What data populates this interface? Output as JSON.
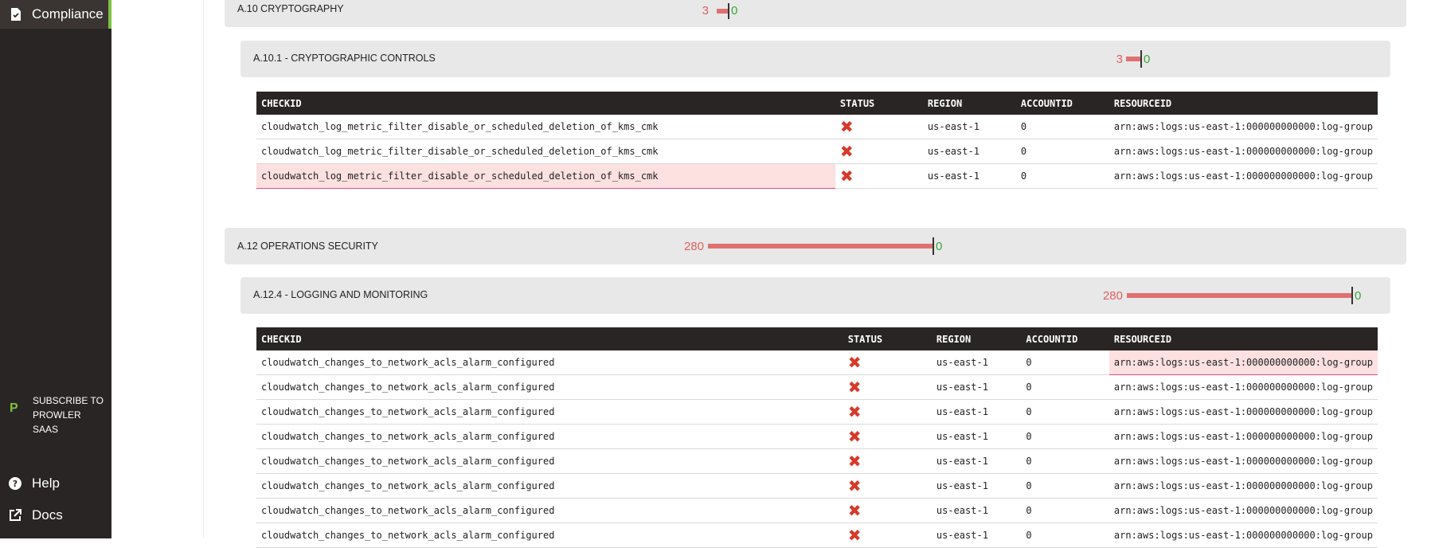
{
  "sidebar": {
    "compliance_label": "Compliance",
    "subscribe_label": "SUBSCRIBE TO PROWLER SAAS",
    "help_label": "Help",
    "docs_label": "Docs",
    "accent_color": "#7bc142"
  },
  "sections": {
    "a10": {
      "title": "A.10 CRYPTOGRAPHY",
      "fail": "3",
      "pass": "0"
    },
    "a101": {
      "title": "A.10.1 - CRYPTOGRAPHIC CONTROLS",
      "fail": "3",
      "pass": "0"
    },
    "a12": {
      "title": "A.12 OPERATIONS SECURITY",
      "fail": "280",
      "pass": "0"
    },
    "a124": {
      "title": "A.12.4 - LOGGING AND MONITORING",
      "fail": "280",
      "pass": "0"
    }
  },
  "table_headers": {
    "checkid": "CHECKID",
    "status": "STATUS",
    "region": "REGION",
    "accountid": "ACCOUNTID",
    "resourceid": "RESOURCEID"
  },
  "table1": {
    "rows": [
      {
        "checkid": "cloudwatch_log_metric_filter_disable_or_scheduled_deletion_of_kms_cmk",
        "status": "fail",
        "region": "us-east-1",
        "accountid": "0",
        "resourceid": "arn:aws:logs:us-east-1:000000000000:log-group"
      },
      {
        "checkid": "cloudwatch_log_metric_filter_disable_or_scheduled_deletion_of_kms_cmk",
        "status": "fail",
        "region": "us-east-1",
        "accountid": "0",
        "resourceid": "arn:aws:logs:us-east-1:000000000000:log-group"
      },
      {
        "checkid": "cloudwatch_log_metric_filter_disable_or_scheduled_deletion_of_kms_cmk",
        "status": "fail",
        "region": "us-east-1",
        "accountid": "0",
        "resourceid": "arn:aws:logs:us-east-1:000000000000:log-group"
      }
    ]
  },
  "table2": {
    "rows": [
      {
        "checkid": "cloudwatch_changes_to_network_acls_alarm_configured",
        "status": "fail",
        "region": "us-east-1",
        "accountid": "0",
        "resourceid": "arn:aws:logs:us-east-1:000000000000:log-group"
      },
      {
        "checkid": "cloudwatch_changes_to_network_acls_alarm_configured",
        "status": "fail",
        "region": "us-east-1",
        "accountid": "0",
        "resourceid": "arn:aws:logs:us-east-1:000000000000:log-group"
      },
      {
        "checkid": "cloudwatch_changes_to_network_acls_alarm_configured",
        "status": "fail",
        "region": "us-east-1",
        "accountid": "0",
        "resourceid": "arn:aws:logs:us-east-1:000000000000:log-group"
      },
      {
        "checkid": "cloudwatch_changes_to_network_acls_alarm_configured",
        "status": "fail",
        "region": "us-east-1",
        "accountid": "0",
        "resourceid": "arn:aws:logs:us-east-1:000000000000:log-group"
      },
      {
        "checkid": "cloudwatch_changes_to_network_acls_alarm_configured",
        "status": "fail",
        "region": "us-east-1",
        "accountid": "0",
        "resourceid": "arn:aws:logs:us-east-1:000000000000:log-group"
      },
      {
        "checkid": "cloudwatch_changes_to_network_acls_alarm_configured",
        "status": "fail",
        "region": "us-east-1",
        "accountid": "0",
        "resourceid": "arn:aws:logs:us-east-1:000000000000:log-group"
      },
      {
        "checkid": "cloudwatch_changes_to_network_acls_alarm_configured",
        "status": "fail",
        "region": "us-east-1",
        "accountid": "0",
        "resourceid": "arn:aws:logs:us-east-1:000000000000:log-group"
      },
      {
        "checkid": "cloudwatch_changes_to_network_acls_alarm_configured",
        "status": "fail",
        "region": "us-east-1",
        "accountid": "0",
        "resourceid": "arn:aws:logs:us-east-1:000000000000:log-group"
      }
    ]
  },
  "status_icon": "x-icon",
  "colors": {
    "fail": "#e07070",
    "pass": "#3aa53a",
    "header_bg": "#292524"
  }
}
